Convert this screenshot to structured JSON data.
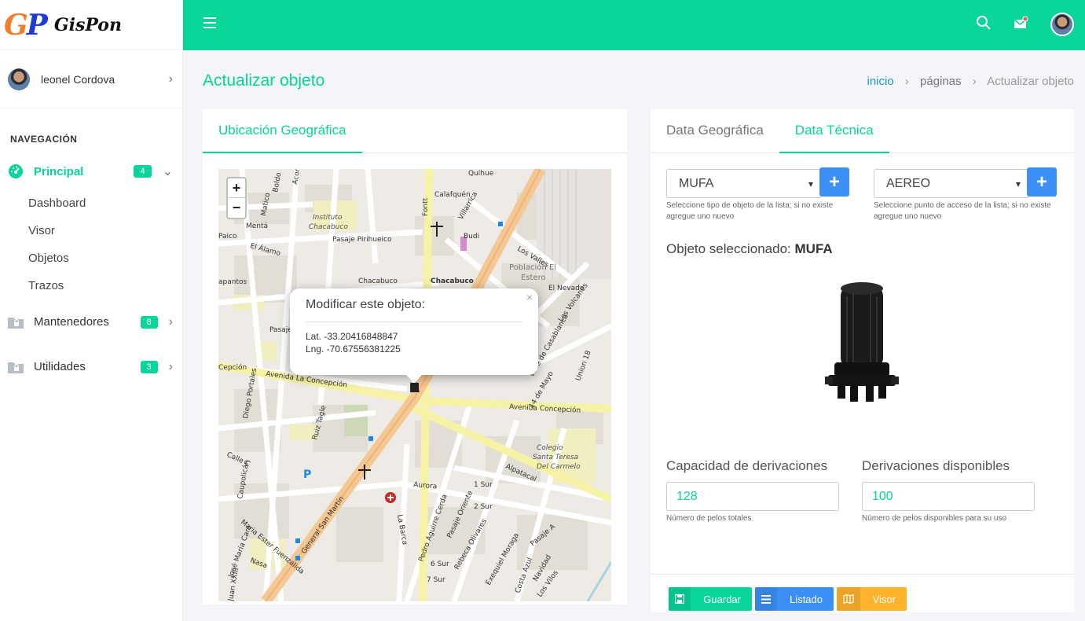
{
  "brand": {
    "logo_g": "G",
    "logo_p": "P",
    "name": "GisPon"
  },
  "user": {
    "name": "leonel Cordova"
  },
  "nav": {
    "title": "NAVEGACIÓN",
    "items": [
      {
        "label": "Principal",
        "badge": "4",
        "icon": "dashboard-icon",
        "active": true,
        "children": [
          "Dashboard",
          "Visor",
          "Objetos",
          "Trazos"
        ]
      },
      {
        "label": "Mantenedores",
        "badge": "8",
        "icon": "lock-folder-icon"
      },
      {
        "label": "Utilidades",
        "badge": "3",
        "icon": "lock-folder-icon"
      }
    ]
  },
  "topbar": {
    "icons": [
      "menu-icon",
      "search-icon",
      "mail-icon",
      "avatar"
    ]
  },
  "page": {
    "title": "Actualizar objeto",
    "breadcrumb": [
      "inicio",
      "páginas",
      "Actualizar objeto"
    ]
  },
  "left_card": {
    "tab": "Ubicación Geográfica",
    "map": {
      "zoom_in": "+",
      "zoom_out": "−",
      "popup": {
        "title": "Modificar este objeto:",
        "lat": "Lat. -33.20416848847",
        "lng": "Lng. -70.67556381225",
        "close": "×"
      },
      "labels": [
        "Calafquén",
        "Villarrica",
        "Instituto Chacabuco",
        "Pasaje Pirihueico",
        "Budi",
        "Los Valles",
        "Población El Estero",
        "Chacabuco",
        "El Nevado",
        "Los Volcanes",
        "Avenida La Concepción",
        "Avenida Concepción",
        "Alpatacal",
        "Colegio Santa Teresa Del Carmelo",
        "General San Martín",
        "La Barca",
        "Aurora",
        "1 Sur",
        "2 Sur",
        "Diego Portales",
        "Ruiz Tagle",
        "Caupolicán",
        "Maria Ester Fuenzalida",
        "Nasa",
        "14 de Mayo",
        "Union 18",
        "Fontt",
        "Pasaje A",
        "Navidad",
        "Costa Azul",
        "Los Vilos",
        "Exequiel Moraga",
        "Rebeca Olivares",
        "Pasaje Oriente",
        "Pedro Aguirre Cerda",
        "El Álamo",
        "Mentá",
        "Matico",
        "Boldo",
        "Paico",
        "Calle C",
        "Juan XXIII",
        "José María Caro",
        "Valle de Casablanca",
        "Pasaje",
        "apantos",
        "Aconcagua",
        "Cepción",
        "Quihue",
        "6 Sur",
        "7 Sur"
      ]
    }
  },
  "right_card": {
    "tabs": [
      "Data Geográfica",
      "Data Técnica"
    ],
    "active_tab": 1,
    "select_object": {
      "value": "MUFA",
      "help": "Seleccione tipo de objeto de la lista; si no existe agregue uno nuevo"
    },
    "select_access": {
      "value": "AEREO",
      "help": "Seleccione punto de acceso de la lista; si no existe agregue uno nuevo"
    },
    "add_label": "+",
    "selected_prefix": "Objeto seleccionado: ",
    "selected_value": "MUFA",
    "capacity": {
      "label": "Capacidad de derivaciones",
      "value": "128",
      "help": "Número de pelos totales"
    },
    "available": {
      "label": "Derivaciones disponibles",
      "value": "100",
      "help": "Número de pelos disponibles para su uso"
    }
  },
  "actions": [
    {
      "label": "Guardar",
      "icon": "save-icon",
      "color": "#07d59a"
    },
    {
      "label": "Listado",
      "icon": "list-icon",
      "color": "#3b8ff5"
    },
    {
      "label": "Visor",
      "icon": "map-icon",
      "color": "#ffb22b"
    }
  ],
  "colors": {
    "accent": "#07d59a",
    "primary": "#3b8ff5",
    "warning": "#ffb22b",
    "link": "#1a9bd8"
  }
}
